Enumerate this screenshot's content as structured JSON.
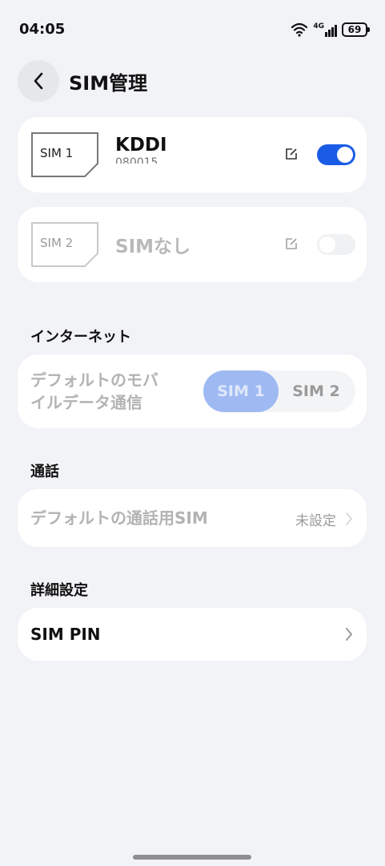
{
  "status_bar": {
    "time": "04:05",
    "battery": "69",
    "signal_label": "4G"
  },
  "header": {
    "title": "SIM管理"
  },
  "sim1": {
    "slot_label": "SIM 1",
    "carrier": "KDDI",
    "number": "080015",
    "enabled": true
  },
  "sim2": {
    "slot_label": "SIM 2",
    "carrier": "SIMなし",
    "enabled": false
  },
  "internet": {
    "section_title": "インターネット",
    "row_label_line1": "デフォルトのモバ",
    "row_label_line2": "イルデータ通信",
    "options": [
      "SIM 1",
      "SIM 2"
    ],
    "selected": "SIM 1"
  },
  "calls": {
    "section_title": "通話",
    "row_label": "デフォルトの通話用SIM",
    "value": "未設定"
  },
  "advanced": {
    "section_title": "詳細設定",
    "row_label": "SIM PIN"
  },
  "colors": {
    "accent": "#1a5ce6",
    "accent_light": "#9fbaf3",
    "card": "#ffffff",
    "background": "#f2f3f7"
  }
}
